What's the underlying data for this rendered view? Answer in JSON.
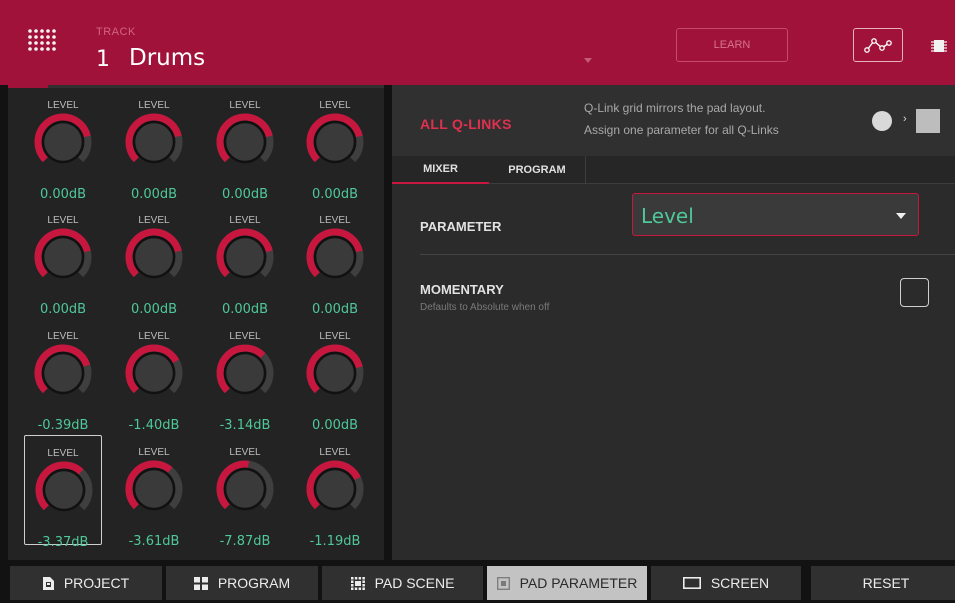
{
  "header": {
    "track_label": "TRACK",
    "track_number": "1",
    "track_name": "Drums",
    "learn_label": "LEARN",
    "icons": [
      "pad-grid-icon",
      "automation-icon",
      "chip-icon"
    ]
  },
  "knobs": [
    {
      "label": "LEVEL",
      "value": "0.00dB",
      "level": 0.785
    },
    {
      "label": "LEVEL",
      "value": "0.00dB",
      "level": 0.785
    },
    {
      "label": "LEVEL",
      "value": "0.00dB",
      "level": 0.785
    },
    {
      "label": "LEVEL",
      "value": "0.00dB",
      "level": 0.785
    },
    {
      "label": "LEVEL",
      "value": "0.00dB",
      "level": 0.785
    },
    {
      "label": "LEVEL",
      "value": "0.00dB",
      "level": 0.785
    },
    {
      "label": "LEVEL",
      "value": "0.00dB",
      "level": 0.785
    },
    {
      "label": "LEVEL",
      "value": "0.00dB",
      "level": 0.785
    },
    {
      "label": "LEVEL",
      "value": "-0.39dB",
      "level": 0.77
    },
    {
      "label": "LEVEL",
      "value": "-1.40dB",
      "level": 0.73
    },
    {
      "label": "LEVEL",
      "value": "-3.14dB",
      "level": 0.67
    },
    {
      "label": "LEVEL",
      "value": "0.00dB",
      "level": 0.785
    },
    {
      "label": "LEVEL",
      "value": "-3.37dB",
      "level": 0.66,
      "selected": true
    },
    {
      "label": "LEVEL",
      "value": "-3.61dB",
      "level": 0.65
    },
    {
      "label": "LEVEL",
      "value": "-7.87dB",
      "level": 0.53
    },
    {
      "label": "LEVEL",
      "value": "-1.19dB",
      "level": 0.74
    }
  ],
  "qlinks": {
    "title": "ALL Q-LINKS",
    "desc1": "Q-Link grid mirrors the pad layout.",
    "desc2": "Assign one parameter for all Q-Links",
    "tabs": [
      "MIXER",
      "PROGRAM"
    ],
    "active_tab": "MIXER",
    "parameter_label": "PARAMETER",
    "parameter_value": "Level",
    "momentary_label": "MOMENTARY",
    "momentary_sub": "Defaults to Absolute when off",
    "momentary_checked": false
  },
  "bottom": {
    "project": "PROJECT",
    "program": "PROGRAM",
    "pad_scene": "PAD SCENE",
    "pad_parameter": "PAD PARAMETER",
    "screen": "SCREEN",
    "reset": "RESET",
    "active": "PAD PARAMETER"
  },
  "colors": {
    "accent": "#a0123a",
    "knob_arc": "#c8173f",
    "value_text": "#4ec89a"
  }
}
